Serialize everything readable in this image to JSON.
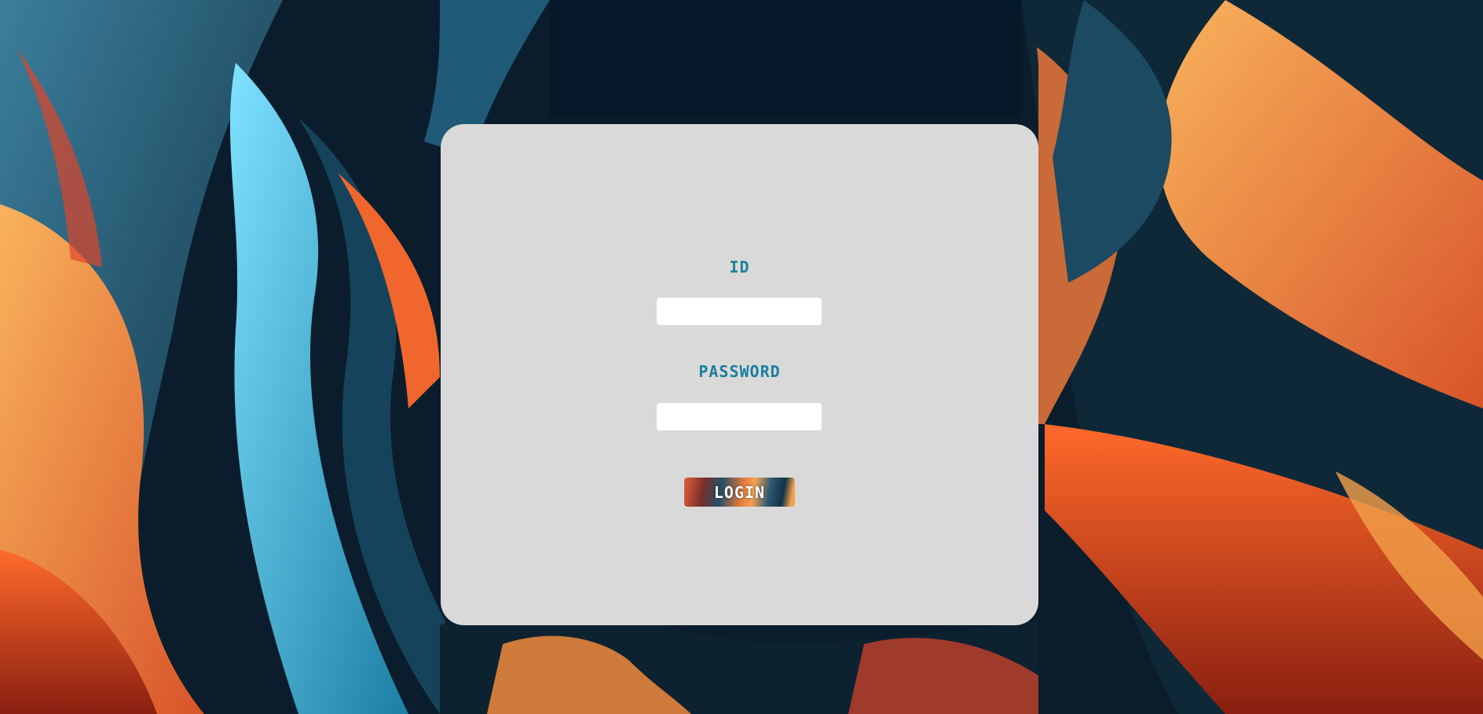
{
  "background": {
    "description_icon": "abstract-swirl-wallpaper",
    "colors": {
      "dark": "#0b1d2c",
      "teal": "#2b5870",
      "cyan": "#4fc6f0",
      "orange": "#f08a3c",
      "red": "#e0452a"
    }
  },
  "login_form": {
    "id_label": "ID",
    "id_value": "",
    "password_label": "PASSWORD",
    "password_value": "",
    "login_button_label": "LOGIN",
    "label_color": "#1b7f9d",
    "card_color": "#d9d9d9"
  }
}
